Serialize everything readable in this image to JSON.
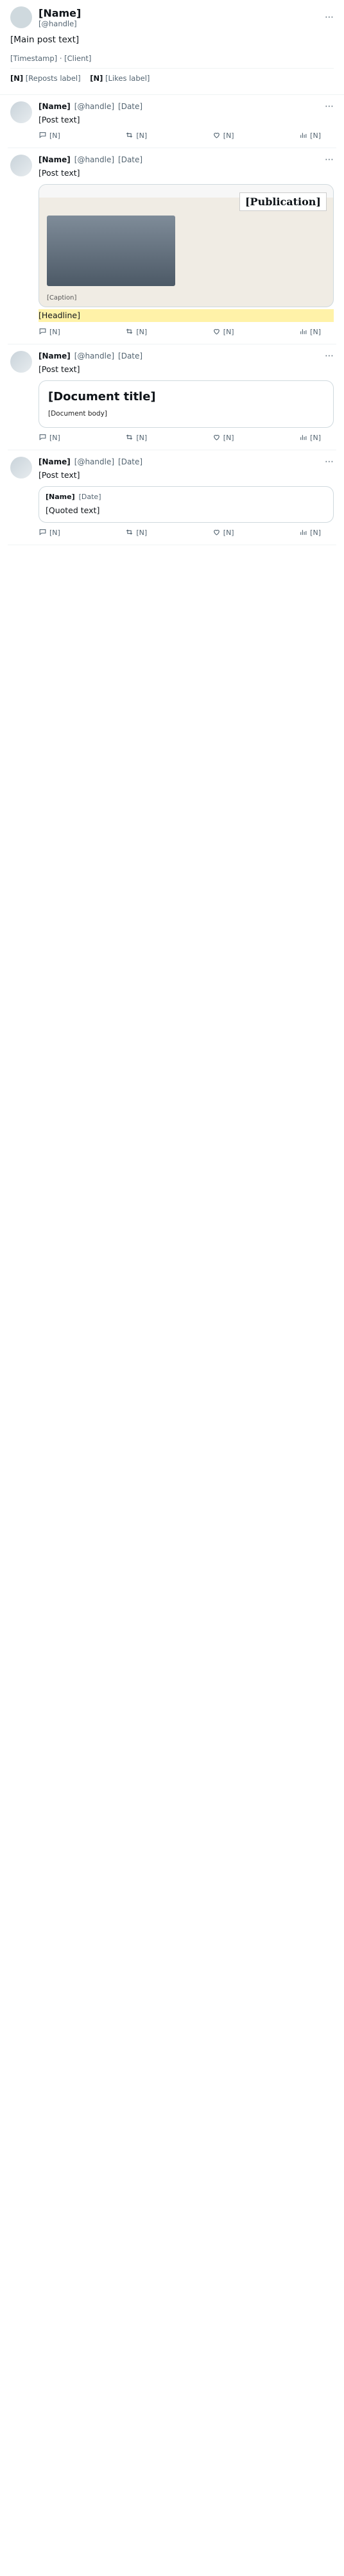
{
  "main": {
    "author_name": "[Name]",
    "handle": "[@handle]",
    "text": "[Main post text]",
    "timestamp": "[Timestamp] · [Client]",
    "reposts": "[N]",
    "reposts_label": "[Reposts label]",
    "likes": "[N]",
    "likes_label": "[Likes label]"
  },
  "thread": [
    {
      "kind": "reply",
      "name": "[Name]",
      "handle": "[@handle]",
      "date": "[Date]",
      "text": "[Post text]",
      "actions": {
        "reply": "[N]",
        "repost": "[N]",
        "like": "[N]",
        "views": "[N]"
      }
    },
    {
      "kind": "reply-with-news",
      "name": "[Name]",
      "handle": "[@handle]",
      "date": "[Date]",
      "text": "[Post text]",
      "news": {
        "logo": "[Publication]",
        "headline": "[Headline]",
        "caption": "[Caption]"
      },
      "actions": {
        "reply": "[N]",
        "repost": "[N]",
        "like": "[N]",
        "views": "[N]"
      }
    },
    {
      "kind": "reply-with-document",
      "name": "[Name]",
      "handle": "[@handle]",
      "date": "[Date]",
      "text": "[Post text]",
      "document": {
        "title": "[Document title]",
        "body": "[Document body]"
      },
      "actions": {
        "reply": "[N]",
        "repost": "[N]",
        "like": "[N]",
        "views": "[N]"
      }
    },
    {
      "kind": "reply",
      "name": "[Name]",
      "handle": "[@handle]",
      "date": "[Date]",
      "text": "[Post text]",
      "quote": {
        "name": "[Name]",
        "date": "[Date]",
        "text": "[Quoted text]"
      },
      "actions": {
        "reply": "[N]",
        "repost": "[N]",
        "like": "[N]",
        "views": "[N]"
      }
    }
  ],
  "icons": {
    "reply": "reply-icon",
    "repost": "repost-icon",
    "like": "heart-icon",
    "views": "views-icon",
    "more": "more-icon"
  },
  "colors": {
    "text": "#0f1419",
    "muted": "#536471",
    "border": "#cfd9de",
    "highlight": "#fff2a8"
  }
}
